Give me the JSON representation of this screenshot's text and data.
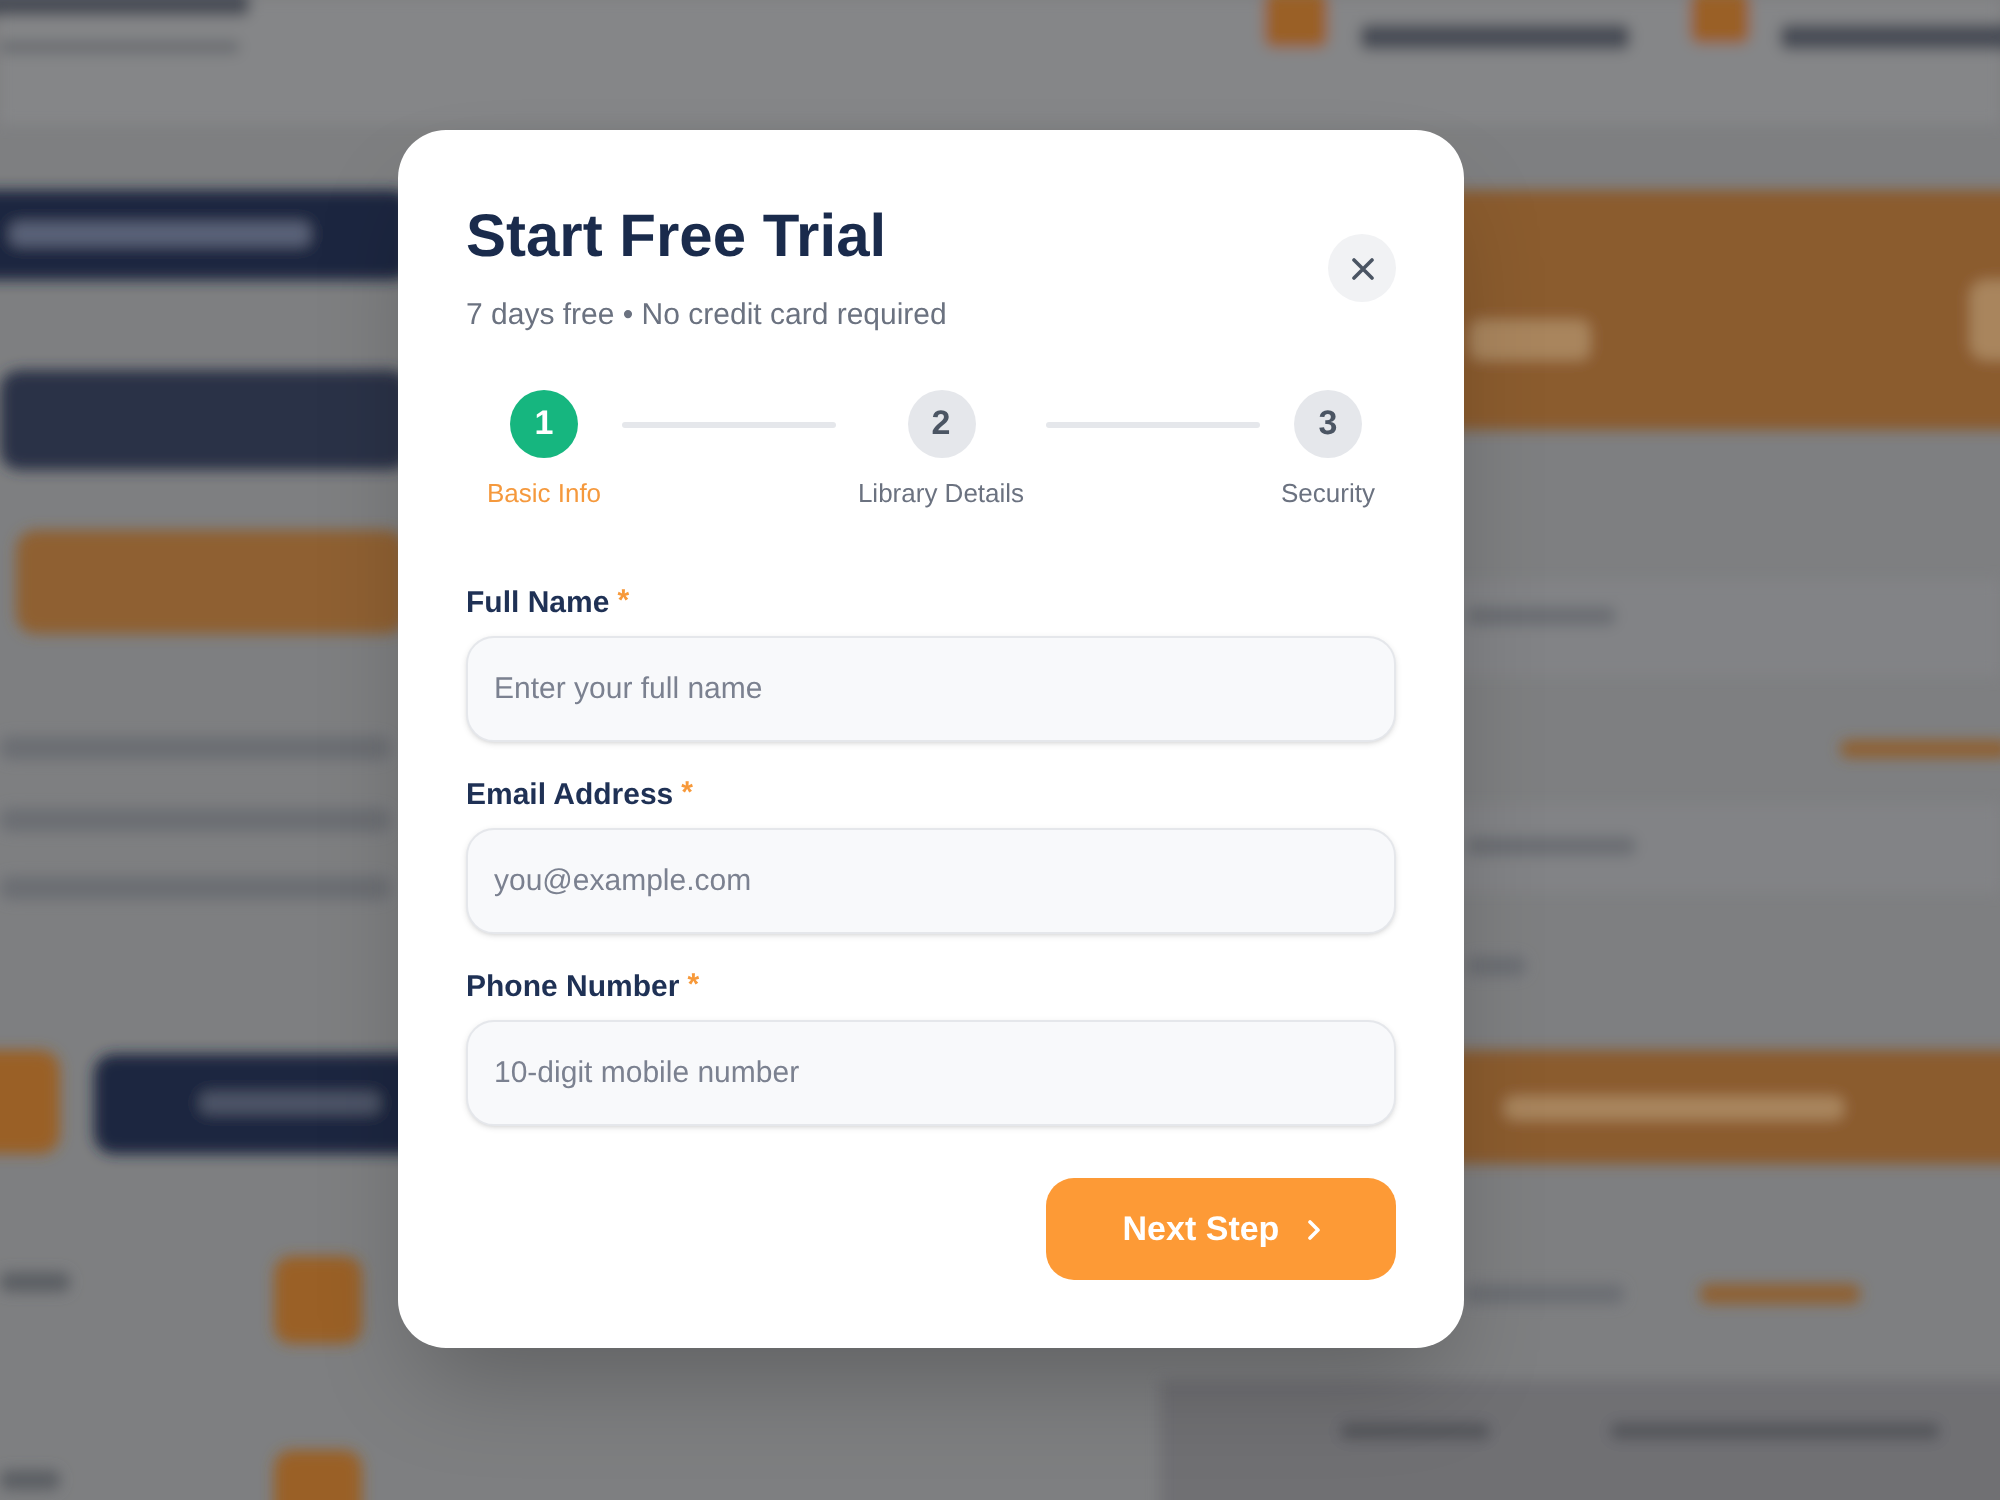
{
  "modal": {
    "title": "Start Free Trial",
    "subtitle": "7 days free • No credit card required",
    "steps": [
      {
        "number": "1",
        "label": "Basic Info",
        "selected": true
      },
      {
        "number": "2",
        "label": "Library Details",
        "selected": false
      },
      {
        "number": "3",
        "label": "Security",
        "selected": false
      }
    ],
    "fields": [
      {
        "label": "Full Name",
        "required_mark": "*",
        "placeholder": "Enter your full name"
      },
      {
        "label": "Email Address",
        "required_mark": "*",
        "placeholder": "you@example.com"
      },
      {
        "label": "Phone Number",
        "required_mark": "*",
        "placeholder": "10-digit mobile number"
      }
    ],
    "next_button": {
      "label": "Next Step"
    }
  }
}
